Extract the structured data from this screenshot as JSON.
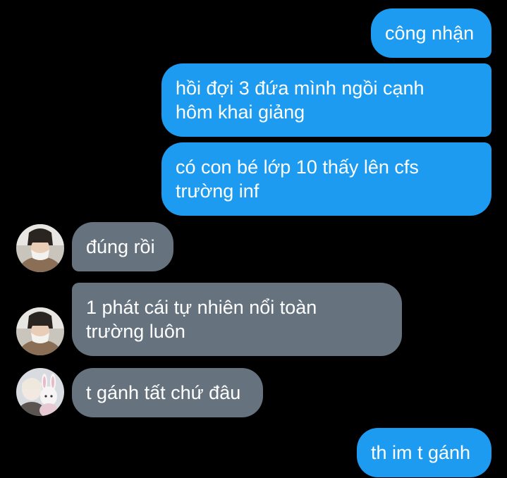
{
  "conversation": {
    "messages": [
      {
        "direction": "outgoing",
        "text": "công nhận"
      },
      {
        "direction": "outgoing",
        "text": "hồi đợi 3 đứa mình ngồi cạnh\nhôm khai giảng"
      },
      {
        "direction": "outgoing",
        "text": "có con bé lớp 10 thấy lên cfs\ntrường inf"
      },
      {
        "direction": "incoming",
        "sender_avatar": "masked-boy-avatar",
        "text": "đúng rồi"
      },
      {
        "direction": "incoming",
        "sender_avatar": "masked-boy-avatar",
        "text": "1 phát cái tự nhiên nổi toàn\ntrường luôn"
      },
      {
        "direction": "incoming",
        "sender_avatar": "plush-toy-avatar",
        "text": "t gánh tất chứ đâu"
      },
      {
        "direction": "outgoing",
        "text": "th im t gánh"
      }
    ]
  },
  "colors": {
    "background": "#000000",
    "outgoing_bubble": "#1d9bf0",
    "incoming_bubble": "#66737f",
    "text": "#ffffff"
  }
}
